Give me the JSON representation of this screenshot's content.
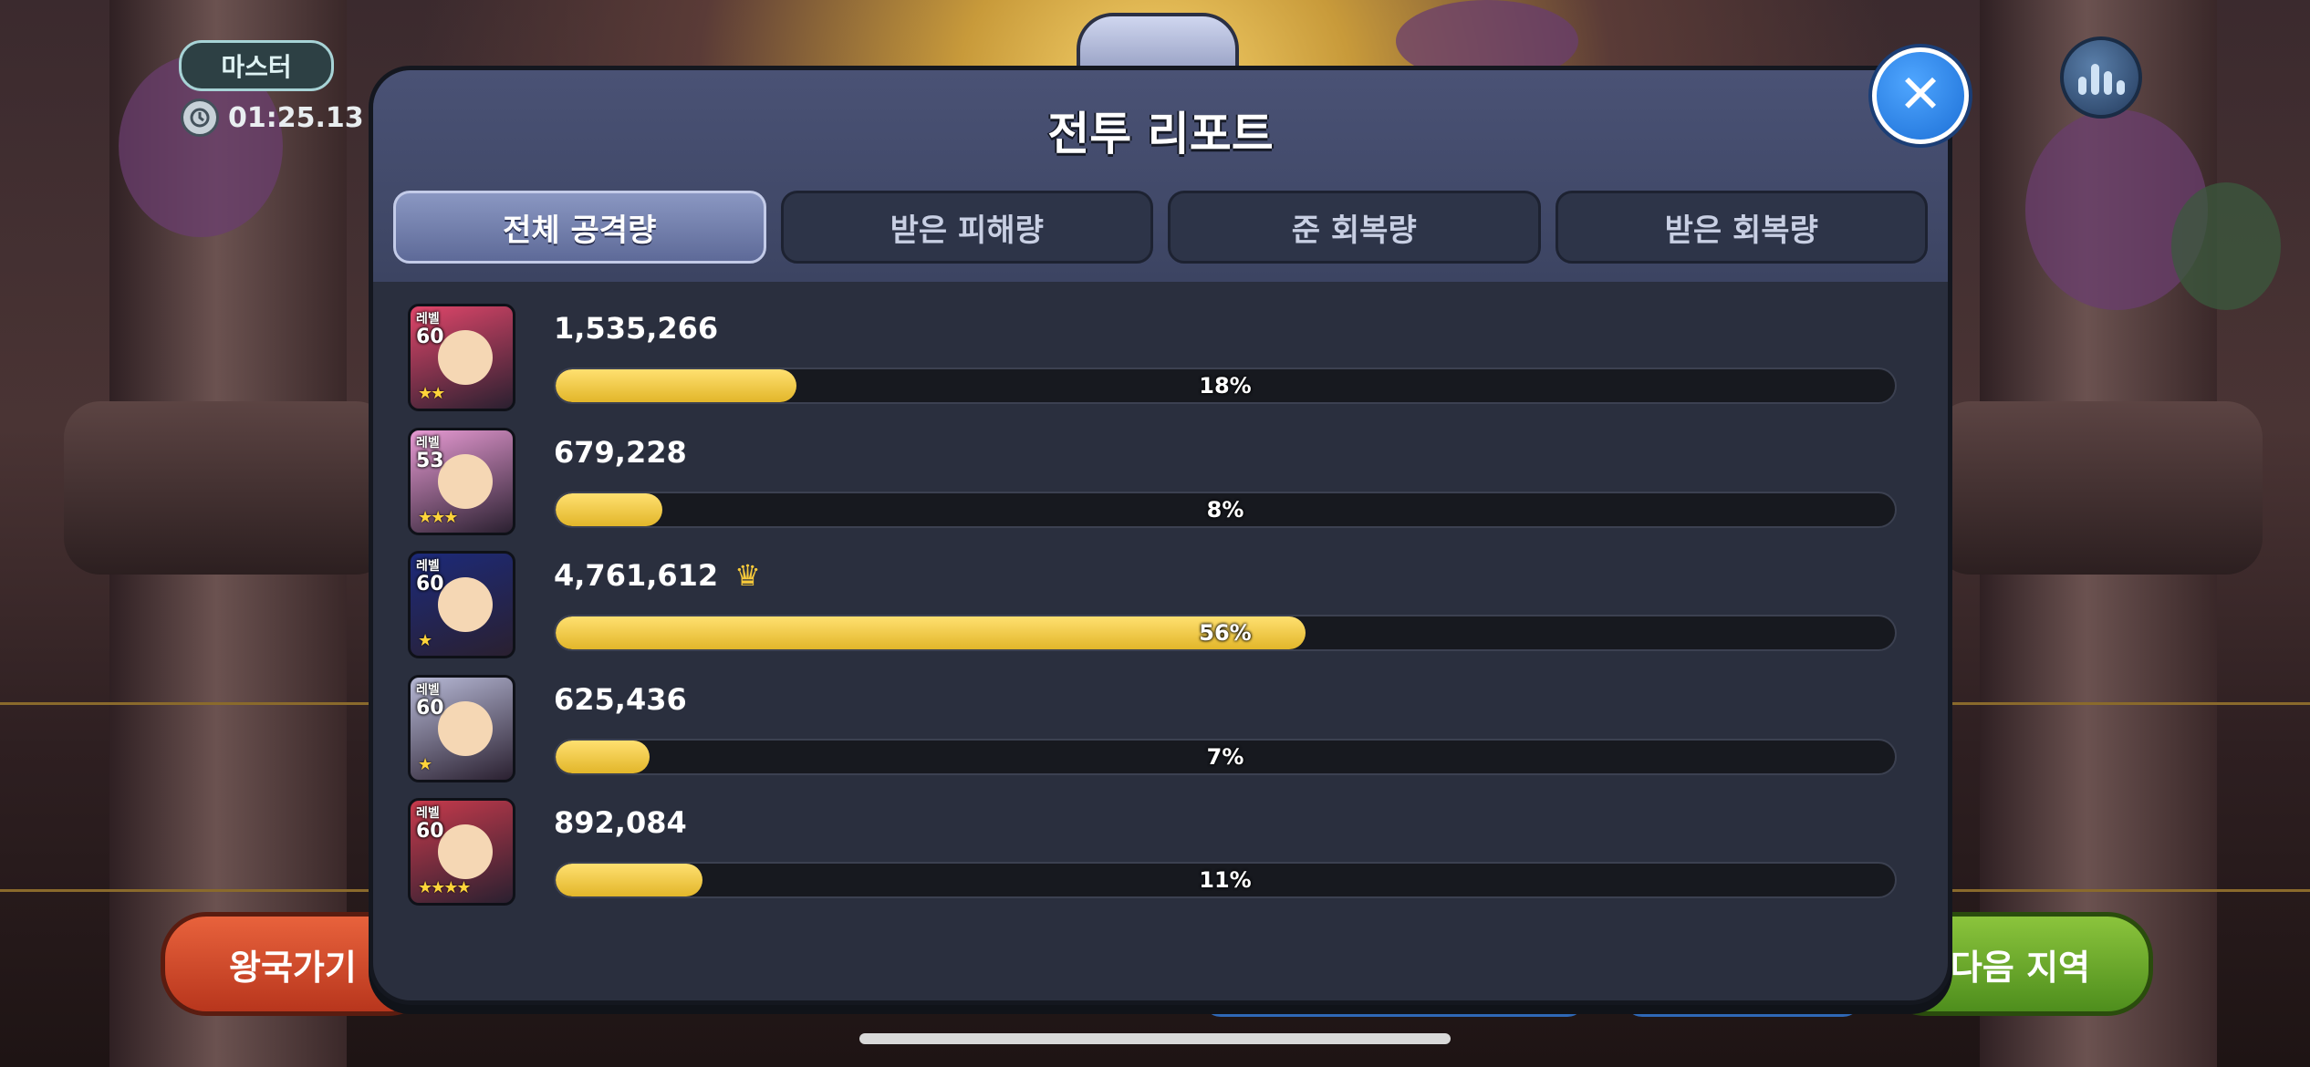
{
  "hud": {
    "mode_badge": "마스터",
    "timer": "01:25.13"
  },
  "modal": {
    "title": "전투 리포트",
    "tabs": [
      {
        "label": "전체 공격량",
        "active": true
      },
      {
        "label": "받은 피해량",
        "active": false
      },
      {
        "label": "준 회복량",
        "active": false
      },
      {
        "label": "받은 회복량",
        "active": false
      }
    ],
    "rows": [
      {
        "level_label": "레벨",
        "level": "60",
        "amount": "1,535,266",
        "percent_label": "18%",
        "percent": 18,
        "stars": "★★",
        "top": false,
        "avatar_color": "#e0466a"
      },
      {
        "level_label": "레벨",
        "level": "53",
        "amount": "679,228",
        "percent_label": "8%",
        "percent": 8,
        "stars": "★★★",
        "top": false,
        "avatar_color": "#e79ad3"
      },
      {
        "level_label": "레벨",
        "level": "60",
        "amount": "4,761,612",
        "percent_label": "56%",
        "percent": 56,
        "stars": "★",
        "top": true,
        "avatar_color": "#1c2a7a"
      },
      {
        "level_label": "레벨",
        "level": "60",
        "amount": "625,436",
        "percent_label": "7%",
        "percent": 7,
        "stars": "★",
        "top": false,
        "avatar_color": "#b7b9d6"
      },
      {
        "level_label": "레벨",
        "level": "60",
        "amount": "892,084",
        "percent_label": "11%",
        "percent": 11,
        "stars": "★★★★",
        "top": false,
        "avatar_color": "#c73a4c"
      }
    ]
  },
  "buttons": {
    "kingdom": "왕국가기",
    "next_region": "다음 지역"
  },
  "icons": {
    "close": "close-icon",
    "stats": "stats-icon",
    "timer": "clock-icon",
    "top": "crown-icon"
  }
}
